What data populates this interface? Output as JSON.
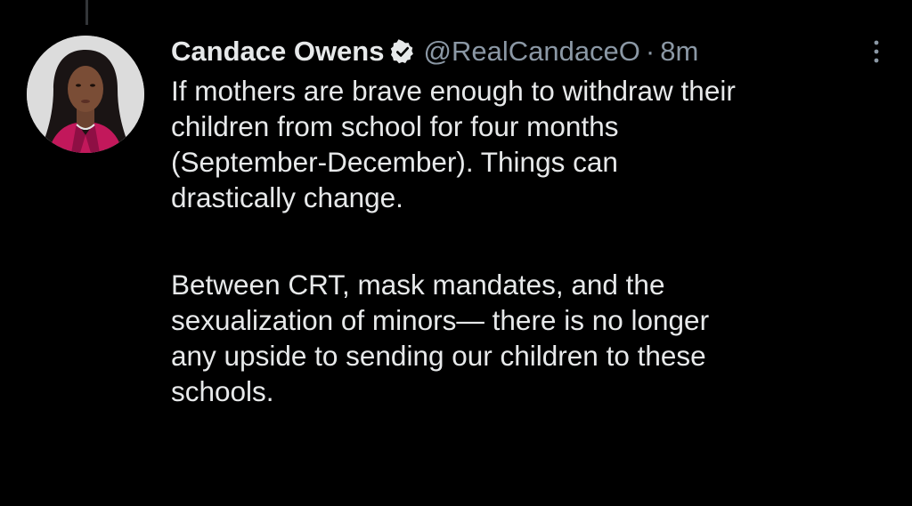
{
  "tweet": {
    "display_name": "Candace Owens",
    "handle": "@RealCandaceO",
    "separator": "·",
    "time": "8m",
    "paragraphs": [
      [
        "If mothers are brave enough to withdraw their",
        "children from school for four months",
        "(September-December). Things can",
        "drastically change."
      ],
      [
        "Between CRT, mask mandates, and the",
        "sexualization of minors— there is no longer",
        "any upside to sending our children to these",
        "schools."
      ]
    ]
  },
  "icons": {
    "verified": "verified-badge-icon",
    "more": "more-options-icon"
  },
  "colors": {
    "background": "#000000",
    "primary_text": "#e7e9ea",
    "secondary_text": "#8b98a5",
    "thread_line": "#333639"
  }
}
